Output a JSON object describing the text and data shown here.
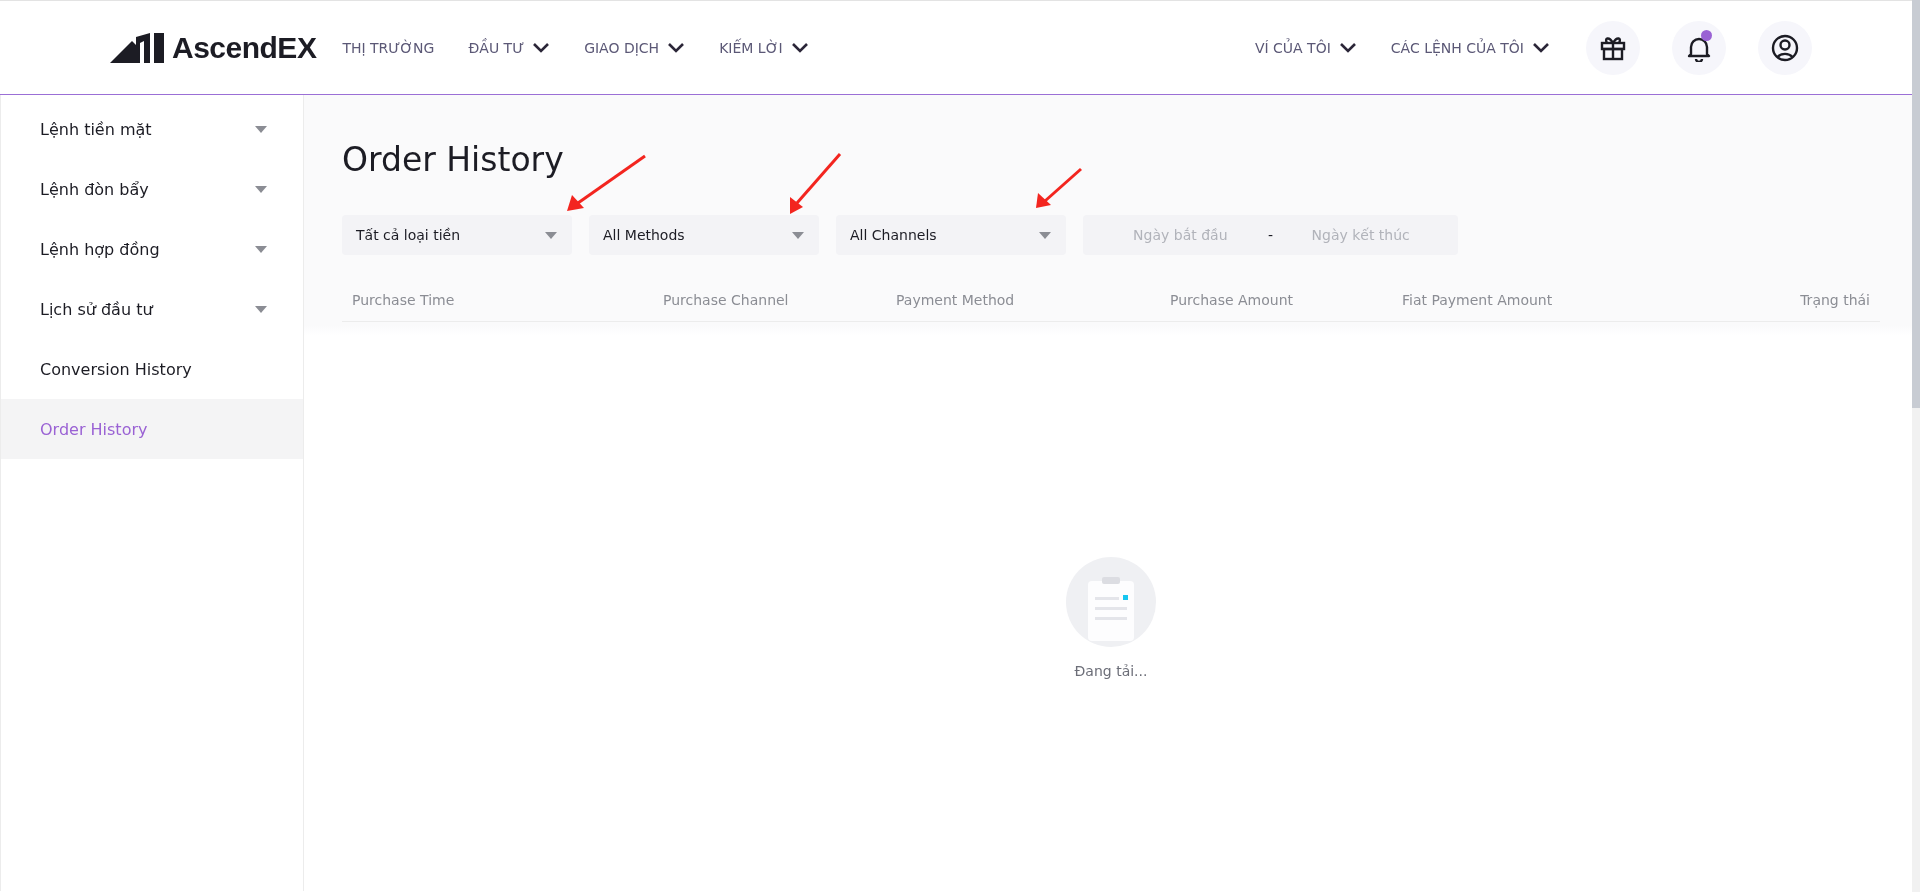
{
  "header": {
    "logo": "AscendEX",
    "nav": [
      {
        "label": "THỊ TRƯỜNG",
        "dropdown": false
      },
      {
        "label": "ĐẦU TƯ",
        "dropdown": true
      },
      {
        "label": "GIAO DỊCH",
        "dropdown": true
      },
      {
        "label": "KIẾM LỜI",
        "dropdown": true
      }
    ],
    "right_nav": [
      {
        "label": "VÍ CỦA TÔI",
        "dropdown": true
      },
      {
        "label": "CÁC LỆNH CỦA TÔI",
        "dropdown": true
      }
    ],
    "icons": [
      {
        "kind": "gift",
        "badge": false
      },
      {
        "kind": "bell",
        "badge": true
      },
      {
        "kind": "user",
        "badge": false
      }
    ]
  },
  "sidebar": {
    "items": [
      {
        "label": "Lệnh tiền mặt",
        "expandable": true,
        "selected": false
      },
      {
        "label": "Lệnh đòn bẩy",
        "expandable": true,
        "selected": false
      },
      {
        "label": "Lệnh hợp đồng",
        "expandable": true,
        "selected": false
      },
      {
        "label": "Lịch sử đầu tư",
        "expandable": true,
        "selected": false
      },
      {
        "label": "Conversion History",
        "expandable": false,
        "selected": false
      },
      {
        "label": "Order History",
        "expandable": false,
        "selected": true
      }
    ]
  },
  "page": {
    "title": "Order History",
    "filters": [
      {
        "kind": "select",
        "value": "Tất cả loại tiền"
      },
      {
        "kind": "select",
        "value": "All Methods"
      },
      {
        "kind": "select",
        "value": "All Channels"
      },
      {
        "kind": "date_range",
        "start_placeholder": "Ngày bắt đầu",
        "separator": "-",
        "end_placeholder": "Ngày kết thúc"
      }
    ],
    "table": {
      "columns": [
        "Purchase Time",
        "Purchase Channel",
        "Payment Method",
        "Purchase Amount",
        "Fiat Payment Amount",
        "Trạng thái"
      ]
    },
    "empty_state": {
      "text": "Đang tải..."
    }
  }
}
